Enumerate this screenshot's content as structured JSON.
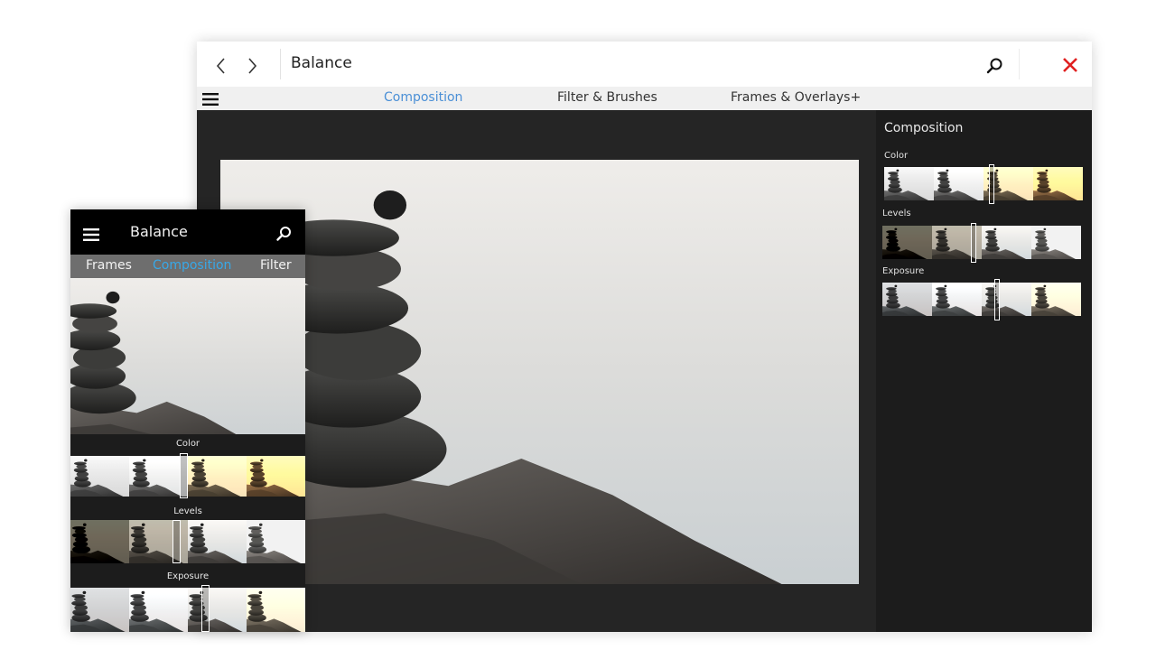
{
  "desktop": {
    "title": "Balance",
    "tabs": [
      {
        "label": "Composition",
        "active": true
      },
      {
        "label": "Filter & Brushes",
        "active": false
      },
      {
        "label": "Frames & Overlays+",
        "active": false
      }
    ],
    "panel": {
      "title": "Composition",
      "sections": [
        {
          "label": "Color"
        },
        {
          "label": "Levels"
        },
        {
          "label": "Exposure"
        }
      ]
    }
  },
  "phone": {
    "title": "Balance",
    "tabs": [
      {
        "label": "Frames",
        "active": false
      },
      {
        "label": "Composition",
        "active": true
      },
      {
        "label": "Filter",
        "active": false
      }
    ],
    "sections": [
      {
        "label": "Color"
      },
      {
        "label": "Levels"
      },
      {
        "label": "Exposure"
      }
    ]
  },
  "colors": {
    "accent_desktop": "#4a8fd6",
    "accent_phone": "#38a8e8",
    "close": "#e02020"
  },
  "icons": [
    "back-icon",
    "forward-icon",
    "search-icon",
    "close-icon",
    "hamburger-icon"
  ]
}
